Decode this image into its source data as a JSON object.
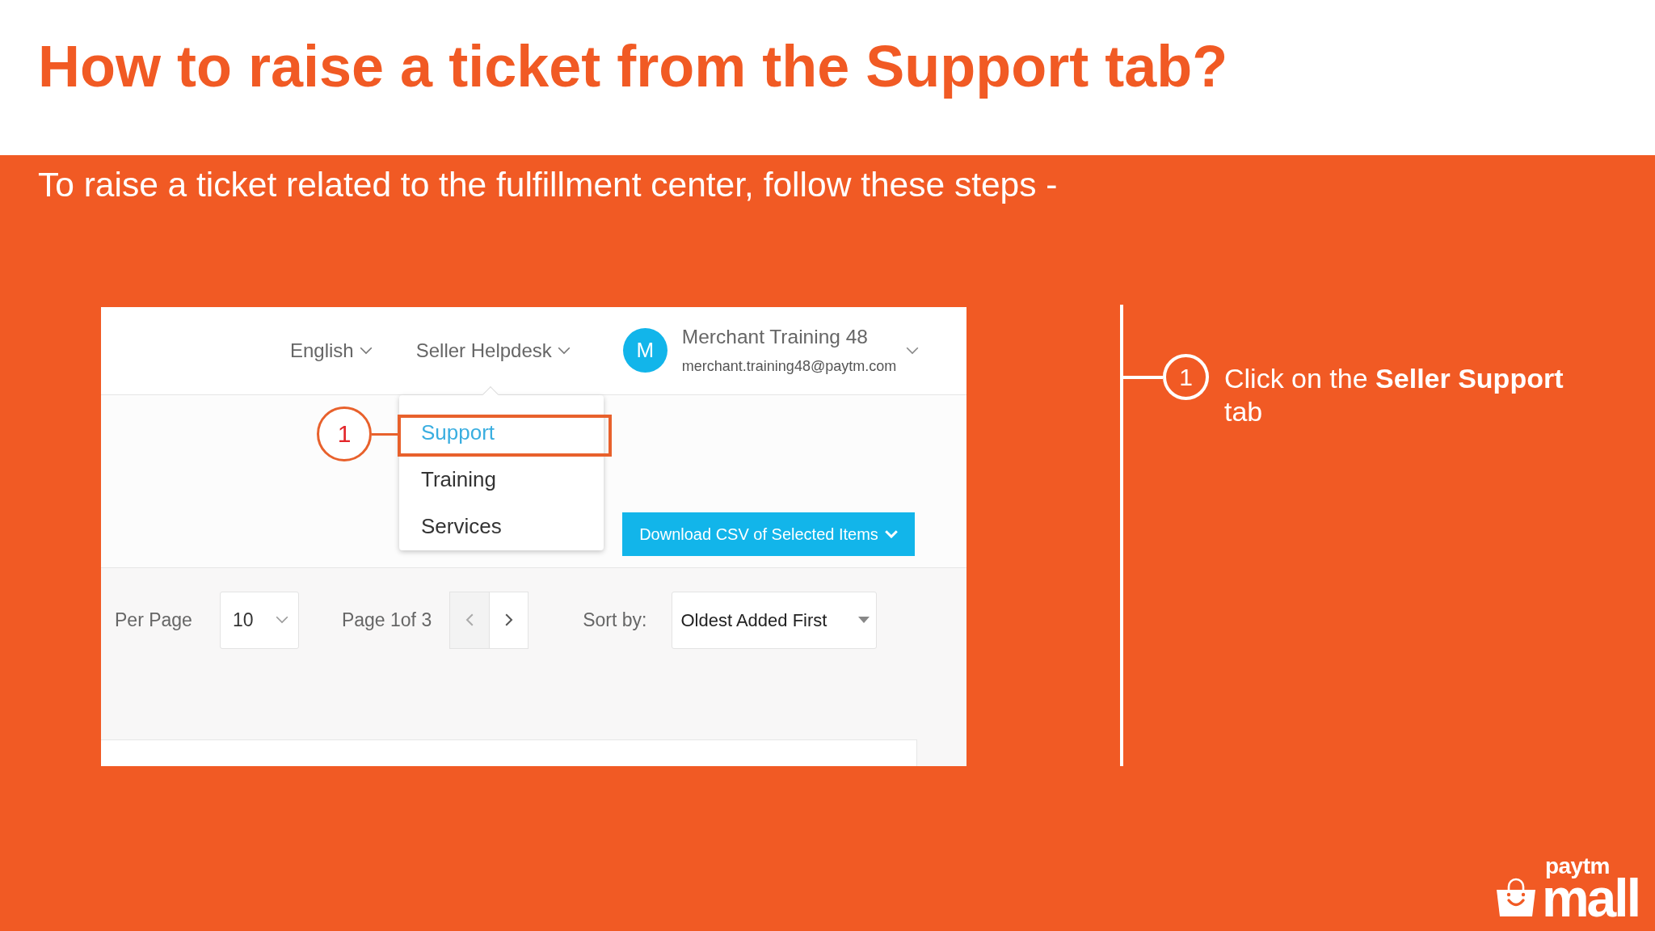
{
  "slide": {
    "title": "How to raise a ticket from the Support tab?",
    "subtitle": "To raise a ticket related to the fulfillment center, follow these steps -"
  },
  "screenshot": {
    "nav": {
      "language": "English",
      "helpdesk": "Seller Helpdesk",
      "user": {
        "initial": "M",
        "name": "Merchant Training 48",
        "email": "merchant.training48@paytm.com"
      }
    },
    "dropdown": {
      "callout": "1",
      "items": [
        {
          "label": "Support",
          "selected": true,
          "highlighted": true
        },
        {
          "label": "Training",
          "selected": false,
          "highlighted": false
        },
        {
          "label": "Services",
          "selected": false,
          "highlighted": false
        }
      ]
    },
    "download_button": "Download CSV of Selected Items",
    "toolbar": {
      "per_page_label": "Per Page",
      "per_page": "10",
      "page_info": "Page 1of 3",
      "sort_label": "Sort by:",
      "sort_value": "Oldest Added First"
    }
  },
  "steps": [
    {
      "number": "1",
      "text": "Click on the **Seller Support** tab"
    }
  ],
  "logo": {
    "small_text": "paytm",
    "large_text": "mall"
  }
}
